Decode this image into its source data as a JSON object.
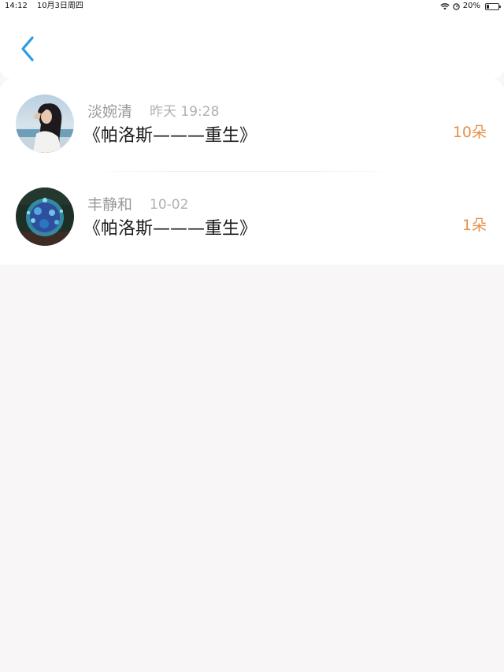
{
  "status_bar": {
    "time": "14:12",
    "date": "10月3日周四",
    "battery_text": "20%",
    "battery_level": 0.2,
    "icons": [
      "wifi-icon",
      "location-icon",
      "battery-icon"
    ]
  },
  "header": {
    "back_icon": "chevron-left-icon",
    "accent_color": "#2b9be8"
  },
  "list": {
    "items": [
      {
        "name": "淡婉清",
        "time": "昨天 19:28",
        "title": "《帕洛斯———重生》",
        "count": "10朵"
      },
      {
        "name": "丰静和",
        "time": "10-02",
        "title": "《帕洛斯———重生》",
        "count": "1朵"
      }
    ]
  },
  "colors": {
    "count": "#e69049",
    "name": "#9a9a9a",
    "background": "#f8f6f7"
  }
}
